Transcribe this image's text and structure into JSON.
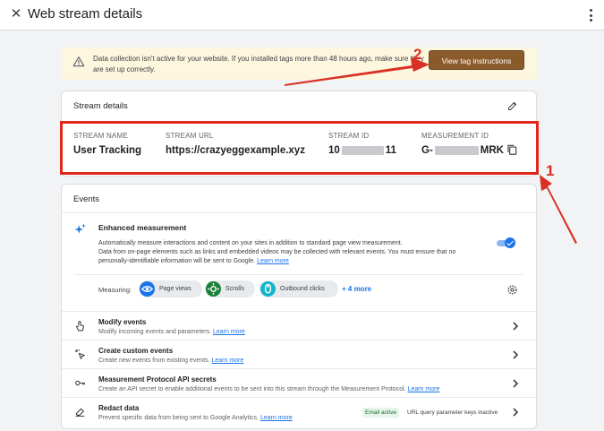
{
  "header": {
    "title": "Web stream details",
    "close_icon": "close-icon",
    "more_icon": "more-vert-icon"
  },
  "alert": {
    "text": "Data collection isn't active for your website. If you installed tags more than 48 hours ago, make sure they are set up correctly.",
    "button_label": "View tag instructions",
    "icon": "warning-icon",
    "button_color": "#8b5a2b"
  },
  "stream_details": {
    "title": "Stream details",
    "fields": [
      {
        "label": "STREAM NAME",
        "value": "User Tracking"
      },
      {
        "label": "STREAM URL",
        "value": "https://crazyeggexample.xyz"
      },
      {
        "label": "STREAM ID",
        "value_prefix": "10",
        "value_suffix": "11"
      },
      {
        "label": "MEASUREMENT ID",
        "value_prefix": "G-",
        "value_suffix": "MRK"
      }
    ]
  },
  "events": {
    "title": "Events",
    "enhanced": {
      "title": "Enhanced measurement",
      "desc_line1": "Automatically measure interactions and content on your sites in addition to standard page view measurement.",
      "desc_line2": "Data from on-page elements such as links and embedded videos may be collected with relevant events. You must ensure that no personally-identifiable information will be sent to Google.",
      "learn_more": "Learn more",
      "enabled": true
    },
    "measuring": {
      "label": "Measuring:",
      "chips": [
        {
          "label": "Page views",
          "icon": "eye-icon",
          "color": "#1a73e8"
        },
        {
          "label": "Scrolls",
          "icon": "scroll-icon",
          "color": "#188038"
        },
        {
          "label": "Outbound clicks",
          "icon": "mouse-icon",
          "color": "#12b5cb"
        }
      ],
      "more_link": "+ 4 more"
    },
    "rows": [
      {
        "title": "Modify events",
        "desc": "Modify incoming events and parameters.",
        "link": "Learn more",
        "icon": "touch-icon"
      },
      {
        "title": "Create custom events",
        "desc": "Create new events from existing events.",
        "link": "Learn more",
        "icon": "sparkle-click-icon"
      },
      {
        "title": "Measurement Protocol API secrets",
        "desc": "Create an API secret to enable additional events to be sent into this stream through the Measurement Protocol.",
        "link": "Learn more",
        "icon": "key-icon"
      },
      {
        "title": "Redact data",
        "desc": "Prevent specific data from being sent to Google Analytics.",
        "link": "Learn more",
        "icon": "eraser-icon",
        "badge": "Email active",
        "badge_note": "URL query parameter keys inactive"
      }
    ]
  },
  "annotations": {
    "one": "1",
    "two": "2",
    "color": "#d93025"
  }
}
